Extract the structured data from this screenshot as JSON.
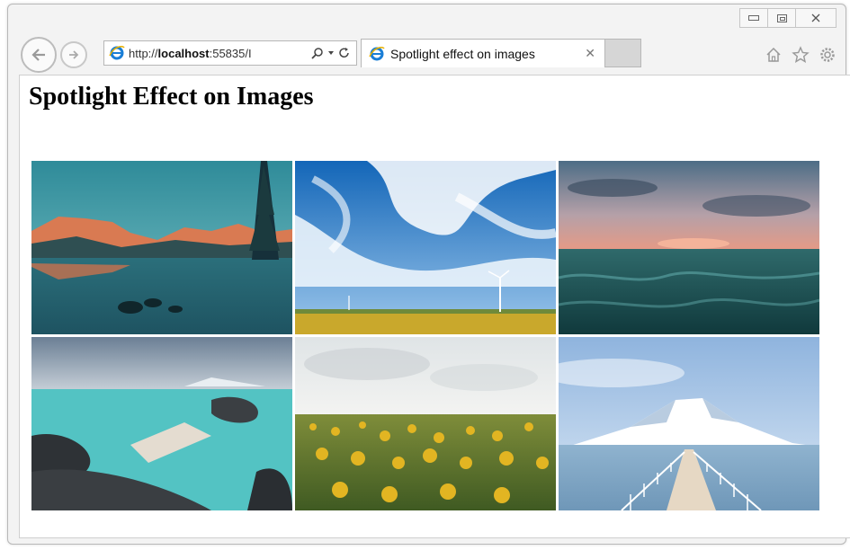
{
  "browser": {
    "url_prefix": "http://",
    "url_host": "localhost",
    "url_rest": ":55835/I",
    "tab_title": "Spotlight effect on images",
    "tab_close": "✕",
    "icons": [
      "back-icon",
      "forward-icon",
      "ie-icon",
      "search-icon",
      "dropdown-icon",
      "refresh-icon",
      "home-icon",
      "favorites-icon",
      "settings-icon"
    ]
  },
  "page": {
    "heading": "Spotlight Effect on Images"
  },
  "gallery": {
    "images": [
      {
        "subject": "mountain lake at sunset"
      },
      {
        "subject": "blue sky with clouds and wind turbines"
      },
      {
        "subject": "ocean waves at sunset"
      },
      {
        "subject": "turquoise lagoon with wooden bridge"
      },
      {
        "subject": "sunflower field"
      },
      {
        "subject": "snowy mountain with pier"
      }
    ]
  },
  "colors": {
    "frame": "#f3f3f3",
    "border": "#b8b8b8",
    "ie_blue": "#1a7ed6"
  }
}
